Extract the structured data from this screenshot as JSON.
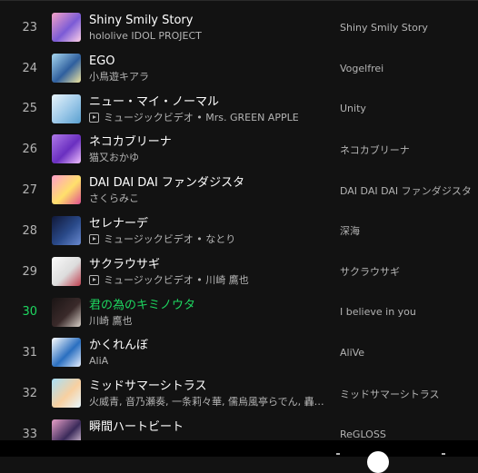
{
  "tracks": [
    {
      "num": "23",
      "title": "Shiny Smily Story",
      "subtitle": "hololive IDOL PROJECT",
      "is_video": false,
      "album": "Shiny Smily Story",
      "active": false
    },
    {
      "num": "24",
      "title": "EGO",
      "subtitle": "小鳥遊キアラ",
      "is_video": false,
      "album": "Vogelfrei",
      "active": false
    },
    {
      "num": "25",
      "title": "ニュー・マイ・ノーマル",
      "subtitle": "ミュージックビデオ • Mrs. GREEN APPLE",
      "is_video": true,
      "album": "Unity",
      "active": false
    },
    {
      "num": "26",
      "title": "ネコカブリーナ",
      "subtitle": "猫又おかゆ",
      "is_video": false,
      "album": "ネコカブリーナ",
      "active": false
    },
    {
      "num": "27",
      "title": "DAI DAI DAI ファンダジスタ",
      "subtitle": "さくらみこ",
      "is_video": false,
      "album": "DAI DAI DAI ファンダジスタ",
      "active": false
    },
    {
      "num": "28",
      "title": "セレナーデ",
      "subtitle": "ミュージックビデオ • なとり",
      "is_video": true,
      "album": "深海",
      "active": false
    },
    {
      "num": "29",
      "title": "サクラウサギ",
      "subtitle": "ミュージックビデオ • 川崎 鷹也",
      "is_video": true,
      "album": "サクラウサギ",
      "active": false
    },
    {
      "num": "30",
      "title": "君の為のキミノウタ",
      "subtitle": "川崎 鷹也",
      "is_video": false,
      "album": "I believe in you",
      "active": true
    },
    {
      "num": "31",
      "title": "かくれんぼ",
      "subtitle": "AliA",
      "is_video": false,
      "album": "AliVe",
      "active": false
    },
    {
      "num": "32",
      "title": "ミッドサマーシトラス",
      "subtitle": "火威青, 音乃瀬奏, 一条莉々華, 儒烏風亭らでん, 轟…",
      "is_video": false,
      "album": "ミッドサマーシトラス",
      "active": false
    },
    {
      "num": "33",
      "title": "瞬間ハートビート",
      "subtitle": "",
      "is_video": false,
      "album": "ReGLOSS",
      "active": false
    }
  ],
  "covers": [
    {
      "colors": [
        "#f5a3c7",
        "#7b5bd6",
        "#ffd1e8"
      ]
    },
    {
      "colors": [
        "#a8d8f0",
        "#2f5f9e",
        "#f0e6a0"
      ]
    },
    {
      "colors": [
        "#e8f4fb",
        "#9cc8e8",
        "#5aa0d0"
      ]
    },
    {
      "colors": [
        "#b07ae8",
        "#6a2fc0",
        "#f0c0ff"
      ]
    },
    {
      "colors": [
        "#ff9ec9",
        "#ffe06b",
        "#e0508f"
      ]
    },
    {
      "colors": [
        "#101838",
        "#2a4a8a",
        "#6a8ad0"
      ]
    },
    {
      "colors": [
        "#fafafa",
        "#dcdcdc",
        "#c04050"
      ]
    },
    {
      "colors": [
        "#1a1414",
        "#3a2a2a",
        "#d8d0c8"
      ]
    },
    {
      "colors": [
        "#ffffff",
        "#2a6fc0",
        "#e8f0ff"
      ]
    },
    {
      "colors": [
        "#a8e0f8",
        "#f8d0a0",
        "#e8f8ff"
      ]
    },
    {
      "colors": [
        "#e8a0c8",
        "#3a2a5a",
        "#f8e0f0"
      ]
    }
  ],
  "accent": "#1ed760"
}
